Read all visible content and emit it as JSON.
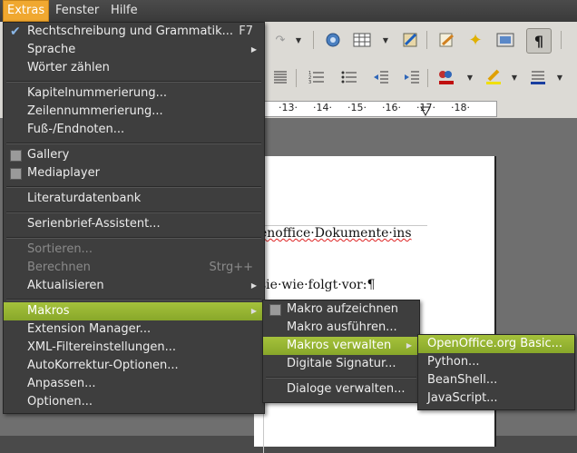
{
  "menubar": {
    "items": [
      {
        "label": "Extras",
        "u": "E",
        "rest": "xtras"
      },
      {
        "label": "Fenster",
        "pre": "Fen",
        "u": "s",
        "rest": "ter"
      },
      {
        "label": "Hilfe",
        "u": "H",
        "rest": "ilfe"
      }
    ]
  },
  "document": {
    "line1": "enoffice·Dokumente·ins",
    "line2": "sie·wie·folgt·vor:¶"
  },
  "ruler": {
    "ticks": [
      "·13·",
      "·14·",
      "·15·",
      "·16·",
      "·17·",
      "·18·"
    ]
  },
  "extras_menu": {
    "items": [
      {
        "label": "Rechtschreibung und Grammatik...",
        "accel": "F7",
        "checked": true
      },
      {
        "label": "Sprache",
        "submenu": true
      },
      {
        "label": "Wörter zählen"
      },
      {
        "label": "Kapitelnummerierung..."
      },
      {
        "label": "Zeilennummerierung..."
      },
      {
        "label": "Fuß-/Endnoten..."
      },
      {
        "label": "Gallery",
        "checkbox": true
      },
      {
        "label": "Mediaplayer",
        "checkbox": true
      },
      {
        "label": "Literaturdatenbank"
      },
      {
        "label": "Serienbrief-Assistent..."
      },
      {
        "label": "Sortieren...",
        "disabled": true
      },
      {
        "label": "Berechnen",
        "accel": "Strg++",
        "disabled": true
      },
      {
        "label": "Aktualisieren",
        "submenu": true
      },
      {
        "label": "Makros",
        "submenu": true,
        "highlighted": true
      },
      {
        "label": "Extension Manager..."
      },
      {
        "label": "XML-Filtereinstellungen..."
      },
      {
        "label": "AutoKorrektur-Optionen..."
      },
      {
        "label": "Anpassen..."
      },
      {
        "label": "Optionen..."
      }
    ]
  },
  "makros_menu": {
    "items": [
      {
        "label": "Makro aufzeichnen",
        "checkbox": true
      },
      {
        "label": "Makro ausführen..."
      },
      {
        "label": "Makros verwalten",
        "submenu": true,
        "highlighted": true
      },
      {
        "label": "Digitale Signatur..."
      },
      {
        "label": "Dialoge verwalten..."
      }
    ]
  },
  "verwalten_menu": {
    "items": [
      {
        "label": "OpenOffice.org Basic...",
        "highlighted": true
      },
      {
        "label": "Python..."
      },
      {
        "label": "BeanShell..."
      },
      {
        "label": "JavaScript..."
      }
    ]
  },
  "colors": {
    "highlight_green": "#95b332",
    "menubar_active": "#f0a830",
    "menu_bg": "#3e3e3e"
  }
}
